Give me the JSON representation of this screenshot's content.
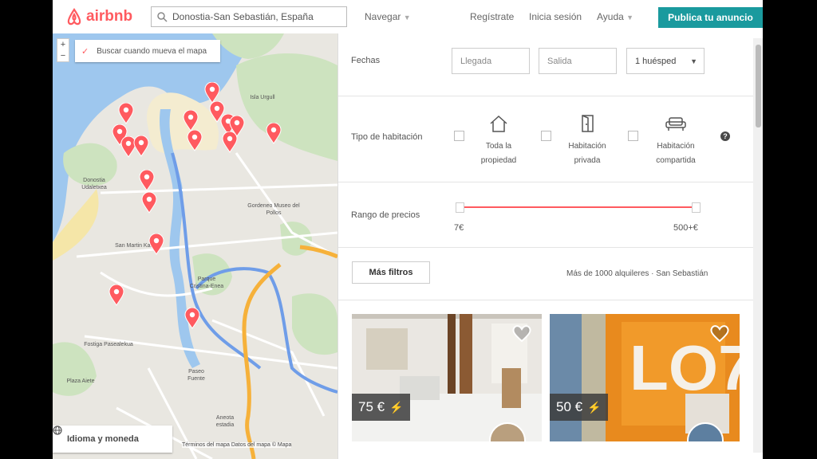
{
  "header": {
    "brand": "airbnb",
    "search_value": "Donostia-San Sebastián, España",
    "nav_browse": "Navegar",
    "nav_signup": "Regístrate",
    "nav_login": "Inicia sesión",
    "nav_help": "Ayuda",
    "publish_label": "Publica tu anuncio"
  },
  "map": {
    "search_on_move_label": "Buscar cuando mueva el mapa",
    "language_label": "Idioma y moneda",
    "attribution": "Términos del mapa  Datos del mapa © Mapa",
    "labels": [
      "Donostia Udaletxea",
      "Gordeneo Museo del Pollos",
      "San Martin Kalea",
      "Parque Cristina-Enea",
      "Paseo Fuente",
      "Aneota estadia",
      "Plaza Aiete",
      "Fostiga Pasealekua",
      "Isla Urgull"
    ]
  },
  "filters": {
    "dates_label": "Fechas",
    "checkin_placeholder": "Llegada",
    "checkout_placeholder": "Salida",
    "guests_value": "1 huésped",
    "room_type_label": "Tipo de habitación",
    "room_types": [
      {
        "label_line1": "Toda la",
        "label_line2": "propiedad",
        "icon": "house-icon"
      },
      {
        "label_line1": "Habitación",
        "label_line2": "privada",
        "icon": "door-icon"
      },
      {
        "label_line1": "Habitación",
        "label_line2": "compartida",
        "icon": "couch-icon"
      }
    ],
    "help_icon": "?",
    "price_range_label": "Rango de precios",
    "price_min": "7€",
    "price_max": "500+€",
    "more_filters_label": "Más filtros",
    "results_summary": "Más de 1000 alquileres · San Sebastián"
  },
  "listings": [
    {
      "price": "75 €",
      "instant_book": true
    },
    {
      "price": "50 €",
      "instant_book": true
    }
  ],
  "colors": {
    "brand": "#ff5a5f",
    "publish": "#1a9a9e"
  }
}
